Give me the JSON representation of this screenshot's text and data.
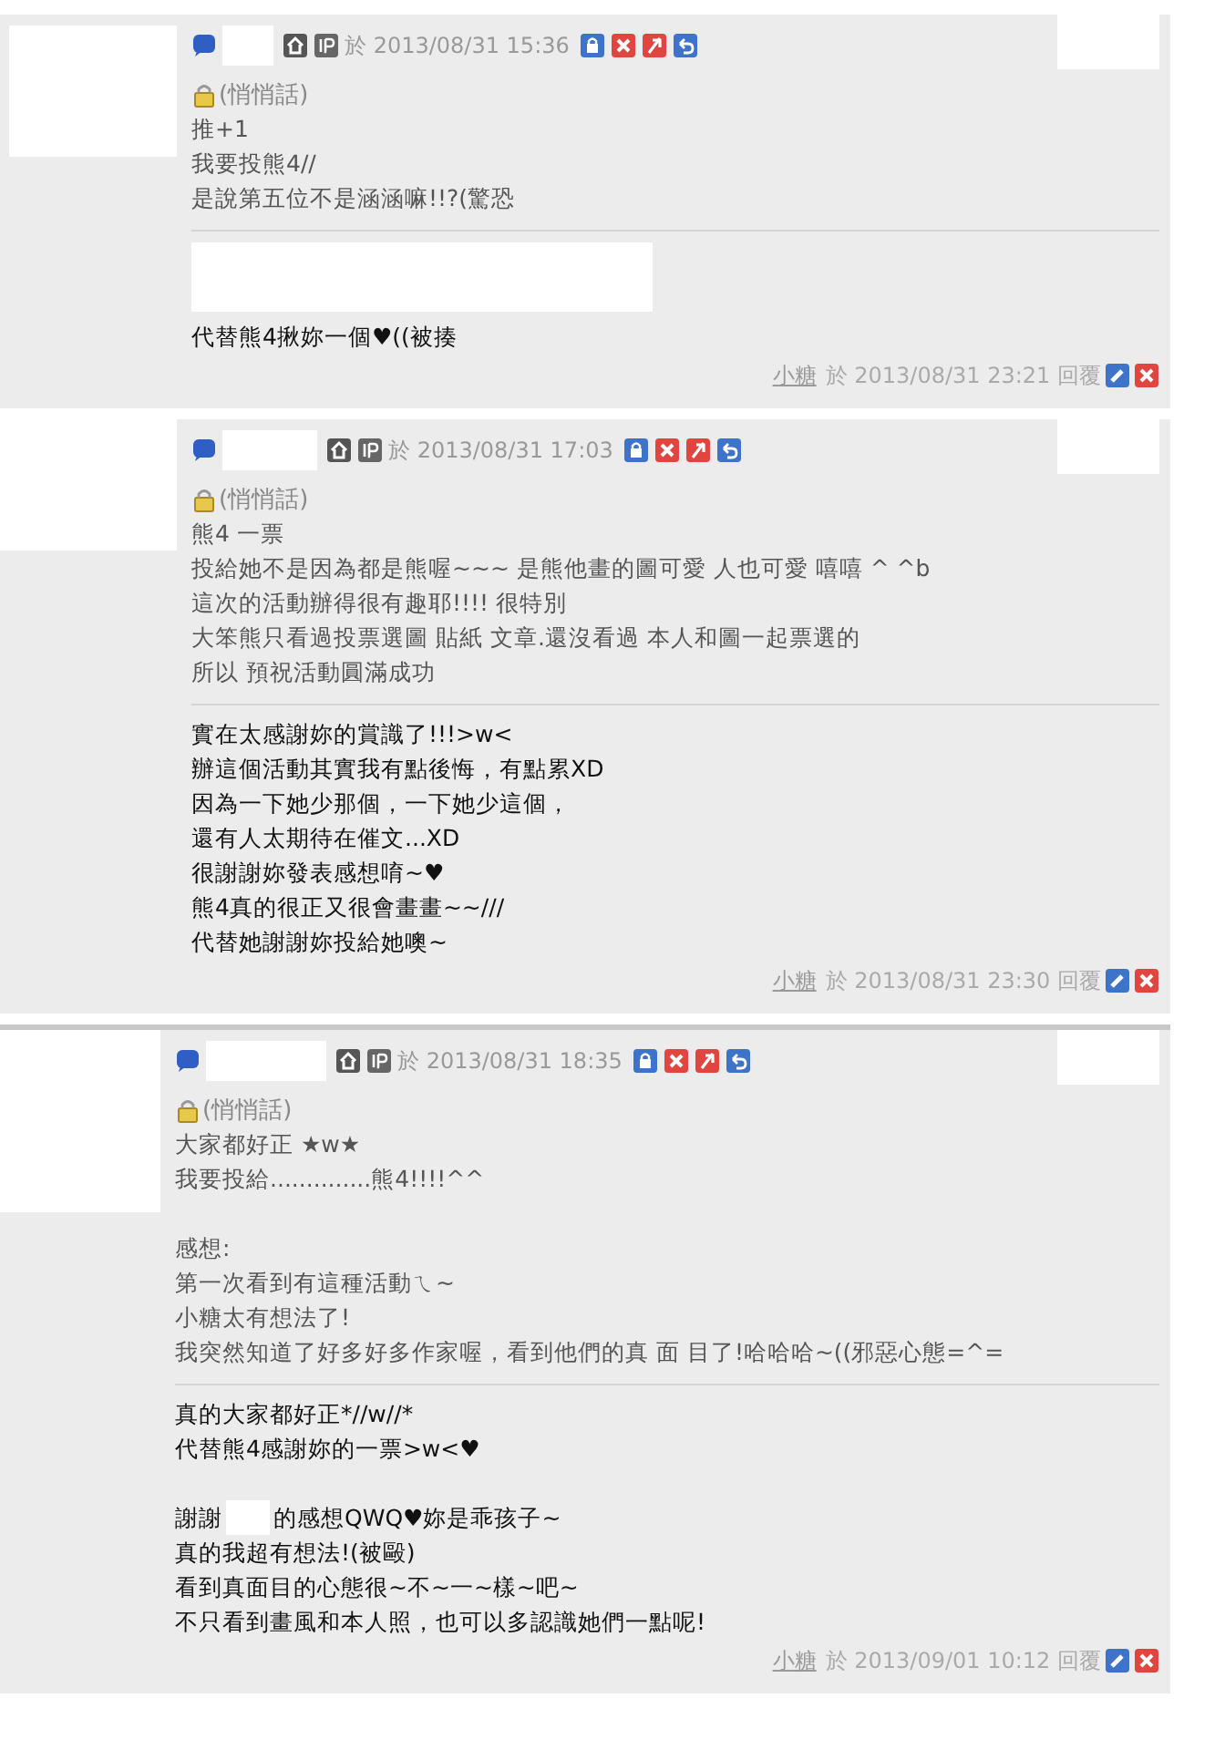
{
  "comments": [
    {
      "posted": "於 2013/08/31 15:36",
      "whisper": "(悄悄話)",
      "lines": [
        {
          "kind": "text",
          "text": "推+1"
        },
        {
          "kind": "text",
          "text": "我要投熊4//"
        },
        {
          "kind": "text",
          "text": "是說第五位不是涵涵嘛!!?(驚恐"
        }
      ],
      "reply": {
        "lines": [
          {
            "kind": "redacted"
          },
          {
            "kind": "text",
            "text": "代替熊4揪妳一個♥((被揍"
          }
        ],
        "author": "小糖",
        "replied": "於 2013/08/31 23:21 回覆"
      }
    },
    {
      "posted": "於 2013/08/31 17:03",
      "whisper": "(悄悄話)",
      "lines": [
        {
          "kind": "text",
          "text": "熊4 一票"
        },
        {
          "kind": "text",
          "text": "投給她不是因為都是熊喔~~~ 是熊他畫的圖可愛 人也可愛 嘻嘻 ^ ^b"
        },
        {
          "kind": "text",
          "text": "這次的活動辦得很有趣耶!!!! 很特別"
        },
        {
          "kind": "text",
          "text": "大笨熊只看過投票選圖 貼紙 文章.還沒看過 本人和圖一起票選的"
        },
        {
          "kind": "text",
          "text": "所以 預祝活動圓滿成功"
        }
      ],
      "reply": {
        "lines": [
          {
            "kind": "text",
            "text": "實在太感謝妳的賞識了!!!>w<"
          },
          {
            "kind": "text",
            "text": "辦這個活動其實我有點後悔，有點累XD"
          },
          {
            "kind": "text",
            "text": "因為一下她少那個，一下她少這個，"
          },
          {
            "kind": "text",
            "text": "還有人太期待在催文...XD"
          },
          {
            "kind": "text",
            "text": "很謝謝妳發表感想唷~♥"
          },
          {
            "kind": "text",
            "text": "熊4真的很正又很會畫畫~~///"
          },
          {
            "kind": "text",
            "text": "代替她謝謝妳投給她噢~"
          }
        ],
        "author": "小糖",
        "replied": "於 2013/08/31 23:30 回覆"
      }
    },
    {
      "posted": "於 2013/08/31 18:35",
      "whisper": "(悄悄話)",
      "lines": [
        {
          "kind": "text",
          "text": "大家都好正 ★w★"
        },
        {
          "kind": "text",
          "text": "我要投給..............熊4!!!!^^"
        },
        {
          "kind": "blank"
        },
        {
          "kind": "text",
          "text": "感想:"
        },
        {
          "kind": "text",
          "text": "第一次看到有這種活動ㄟ~"
        },
        {
          "kind": "text",
          "text": "小糖太有想法了!"
        },
        {
          "kind": "text",
          "text": "我突然知道了好多好多作家喔，看到他們的真 面 目了!哈哈哈~((邪惡心態=^="
        }
      ],
      "reply": {
        "lines": [
          {
            "kind": "text",
            "text": "真的大家都好正*//w//*"
          },
          {
            "kind": "text",
            "text": "代替熊4感謝妳的一票>w<♥"
          },
          {
            "kind": "blank"
          },
          {
            "kind": "mention",
            "before": "謝謝",
            "after": "的感想QWQ♥妳是乖孩子~"
          },
          {
            "kind": "text",
            "text": "真的我超有想法!(被毆)"
          },
          {
            "kind": "text",
            "text": "看到真面目的心態很~不~一~樣~吧~"
          },
          {
            "kind": "text",
            "text": "不只看到畫風和本人照，也可以多認識她們一點呢!"
          }
        ],
        "author": "小糖",
        "replied": "於 2013/09/01 10:12 回覆"
      }
    }
  ]
}
